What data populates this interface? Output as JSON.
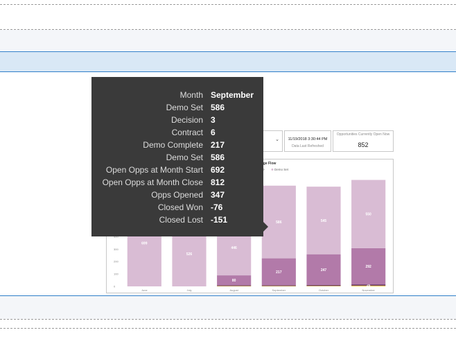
{
  "card_timestamp": {
    "value": "11/19/2018 3:30:44 PM",
    "caption": "Data Last Refreshed"
  },
  "card_open_opps": {
    "title": "Opportunities Currently Open Now",
    "value": "852"
  },
  "chart_data": {
    "type": "bar",
    "title_fragment": "Stage Flow",
    "legend_fragment": [
      "plete",
      "Demo Set"
    ],
    "categories": [
      "June",
      "July",
      "August",
      "September",
      "October",
      "November"
    ],
    "series": [
      {
        "name": "Demo Set",
        "color": "#d9bcd4",
        "values": [
          699,
          526,
          446,
          586,
          545,
          550
        ]
      },
      {
        "name": "Demo Complete",
        "color": "#b27aa9",
        "values": [
          0,
          0,
          80,
          217,
          247,
          292
        ]
      },
      {
        "name": "Contract",
        "color": "#6d3a64",
        "values": [
          0,
          0,
          6,
          6,
          8,
          10
        ]
      },
      {
        "name": "Decision",
        "color": "#e8c84a",
        "values": [
          0,
          0,
          3,
          3,
          4,
          6
        ]
      }
    ],
    "data_labels": [
      {
        "category": "June",
        "series": "Demo Set",
        "text": "699"
      },
      {
        "category": "July",
        "series": "Demo Set",
        "text": "526"
      },
      {
        "category": "August",
        "series": "Demo Set",
        "text": "446"
      },
      {
        "category": "August",
        "series": "Demo Complete",
        "text": "80"
      },
      {
        "category": "September",
        "series": "Demo Set",
        "text": "586"
      },
      {
        "category": "September",
        "series": "Demo Complete",
        "text": "217"
      },
      {
        "category": "October",
        "series": "Demo Set",
        "text": "545"
      },
      {
        "category": "October",
        "series": "Demo Complete",
        "text": "247"
      },
      {
        "category": "November",
        "series": "Demo Set",
        "text": "550"
      },
      {
        "category": "November",
        "series": "Demo Complete",
        "text": "292"
      },
      {
        "category": "November",
        "series": "Contract",
        "text": "26"
      }
    ],
    "y_ticks": [
      0,
      100,
      200,
      300,
      400,
      500,
      600,
      700,
      800,
      900
    ],
    "ylim": [
      0,
      900
    ]
  },
  "tooltip": {
    "rows": [
      {
        "label": "Month",
        "value": "September"
      },
      {
        "label": "Demo Set",
        "value": "586"
      },
      {
        "label": "Decision",
        "value": "3"
      },
      {
        "label": "Contract",
        "value": "6"
      },
      {
        "label": "Demo Complete",
        "value": "217"
      },
      {
        "label": "Demo Set",
        "value": "586"
      },
      {
        "label": "Open Opps at Month Start",
        "value": "692"
      },
      {
        "label": "Open Opps at Month Close",
        "value": "812"
      },
      {
        "label": "Opps Opened",
        "value": "347"
      },
      {
        "label": "Closed Won",
        "value": "-76"
      },
      {
        "label": "Closed Lost",
        "value": "-151"
      }
    ]
  }
}
